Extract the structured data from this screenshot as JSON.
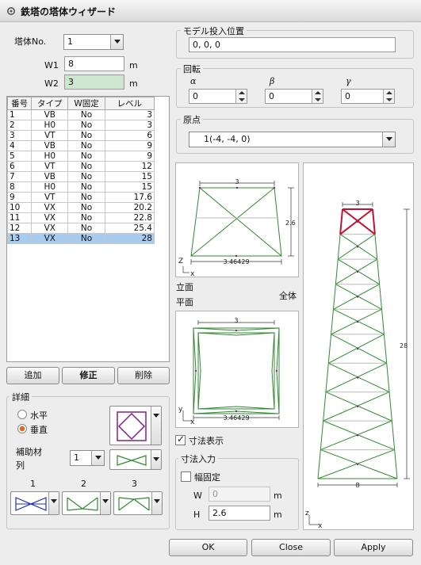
{
  "window": {
    "title": "鉄塔の塔体ウィザード",
    "icon": "gear-icon"
  },
  "left": {
    "tower_no_label": "塔体No.",
    "tower_no_value": "1",
    "w1_label": "W1",
    "w1_value": "8",
    "w1_unit": "m",
    "w2_label": "W2",
    "w2_value": "3",
    "w2_unit": "m",
    "table": {
      "headers": [
        "番号",
        "タイプ",
        "W固定",
        "レベル"
      ],
      "rows": [
        [
          "1",
          "VB",
          "No",
          "3"
        ],
        [
          "2",
          "H0",
          "No",
          "3"
        ],
        [
          "3",
          "VT",
          "No",
          "6"
        ],
        [
          "4",
          "VB",
          "No",
          "9"
        ],
        [
          "5",
          "H0",
          "No",
          "9"
        ],
        [
          "6",
          "VT",
          "No",
          "12"
        ],
        [
          "7",
          "VB",
          "No",
          "15"
        ],
        [
          "8",
          "H0",
          "No",
          "15"
        ],
        [
          "9",
          "VT",
          "No",
          "17.6"
        ],
        [
          "10",
          "VX",
          "No",
          "20.2"
        ],
        [
          "11",
          "VX",
          "No",
          "22.8"
        ],
        [
          "12",
          "VX",
          "No",
          "25.4"
        ],
        [
          "13",
          "VX",
          "No",
          "28"
        ]
      ],
      "selected_row": 12
    },
    "buttons": {
      "add": "追加",
      "edit": "修正",
      "delete": "削除"
    },
    "detail": {
      "group_label": "詳細",
      "horizontal": "水平",
      "vertical": "垂直",
      "selected": "vertical",
      "aux_label_1": "補助材",
      "aux_label_2": "列",
      "aux_value": "1",
      "pattern_labels": [
        "1",
        "2",
        "3"
      ]
    }
  },
  "right": {
    "model_pos": {
      "label": "モデル投入位置",
      "value": "0, 0, 0"
    },
    "rotation": {
      "label": "回転",
      "alpha_label": "α",
      "beta_label": "β",
      "gamma_label": "γ",
      "alpha": "0",
      "beta": "0",
      "gamma": "0"
    },
    "origin": {
      "label": "原点",
      "value": "1(-4, -4, 0)"
    },
    "views": {
      "elevation_label": "立面",
      "plan_label": "平面",
      "overall_label": "全体",
      "elev_top_dim": "3",
      "elev_height_dim": "2.6",
      "elev_bottom_dim": "3.46429",
      "plan_top_dim": "3",
      "plan_bottom_dim": "3.46429",
      "full_top_dim": "3",
      "full_height_dim": "28",
      "full_bottom_dim": "8",
      "axis_z": "Z",
      "axis_x": "x",
      "axis_y": "y",
      "axis_z_lower": "z"
    },
    "dim_display": {
      "label": "寸法表示",
      "checked": true
    },
    "dim_input": {
      "label": "寸法入力",
      "width_fixed_label": "幅固定",
      "width_fixed": false,
      "w_label": "W",
      "w_value": "0",
      "w_unit": "m",
      "h_label": "H",
      "h_value": "2.6",
      "h_unit": "m"
    }
  },
  "footer": {
    "ok": "OK",
    "close": "Close",
    "apply": "Apply"
  },
  "colors": {
    "member": "#2e8b2e",
    "highlight": "#c8102e",
    "selected_row": "#a9cbee",
    "dim": "#333333"
  }
}
